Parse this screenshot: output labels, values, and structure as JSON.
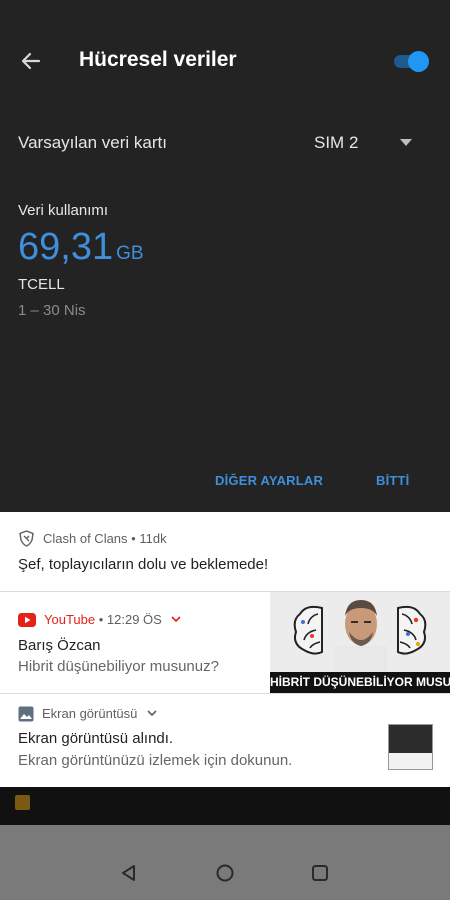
{
  "header": {
    "title": "Hücresel veriler",
    "toggle_on": true
  },
  "sim": {
    "label": "Varsayılan veri kartı",
    "value": "SIM 2"
  },
  "usage": {
    "label": "Veri kullanımı",
    "amount": "69,31",
    "unit": "GB",
    "operator": "TCELL",
    "period": "1 – 30 Nis"
  },
  "actions": {
    "more_settings": "DİĞER AYARLAR",
    "done": "BİTTİ"
  },
  "notifications": [
    {
      "app": "Clash of Clans",
      "time": "11dk",
      "text": "Şef, toplayıcıların dolu ve beklemede!"
    },
    {
      "app": "YouTube",
      "time": "12:29 ÖS",
      "title": "Barış Özcan",
      "text": "Hibrit düşünebiliyor musunuz?",
      "thumbnail_caption": "HİBRİT DÜŞÜNEBİLİYOR MUSUNUZ?"
    },
    {
      "app": "Ekran görüntüsü",
      "title": "Ekran görüntüsü alındı.",
      "text": "Ekran görüntünüzü izlemek için dokunun."
    }
  ],
  "colors": {
    "accent": "#3f8fdc",
    "youtube_red": "#e62117",
    "panel_bg": "#232323"
  }
}
